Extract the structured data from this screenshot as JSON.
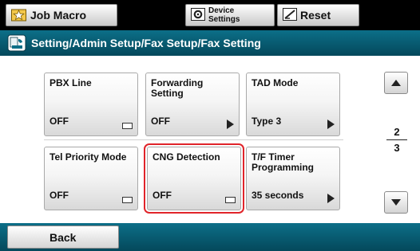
{
  "topbar": {
    "job_macro_label": "Job Macro",
    "device_settings_line1": "Device",
    "device_settings_line2": "Settings",
    "reset_label": "Reset"
  },
  "title": {
    "path": "Setting/Admin Setup/Fax Setup/Fax Setting"
  },
  "tiles": [
    {
      "name": "PBX Line",
      "value": "OFF",
      "icon": "list-box-icon"
    },
    {
      "name": "Forwarding Setting",
      "value": "OFF",
      "icon": "arrow-right-icon"
    },
    {
      "name": "TAD Mode",
      "value": "Type 3",
      "icon": "arrow-right-icon"
    },
    {
      "name": "Tel Priority Mode",
      "value": "OFF",
      "icon": "list-box-icon"
    },
    {
      "name": "CNG Detection",
      "value": "OFF",
      "icon": "list-box-icon"
    },
    {
      "name": "T/F Timer Programming",
      "value": "35 seconds",
      "icon": "arrow-right-icon"
    }
  ],
  "pager": {
    "current": "2",
    "total": "3"
  },
  "bottom": {
    "back_label": "Back"
  },
  "colors": {
    "accent": "#0c6f88",
    "selection": "#e0242a"
  }
}
